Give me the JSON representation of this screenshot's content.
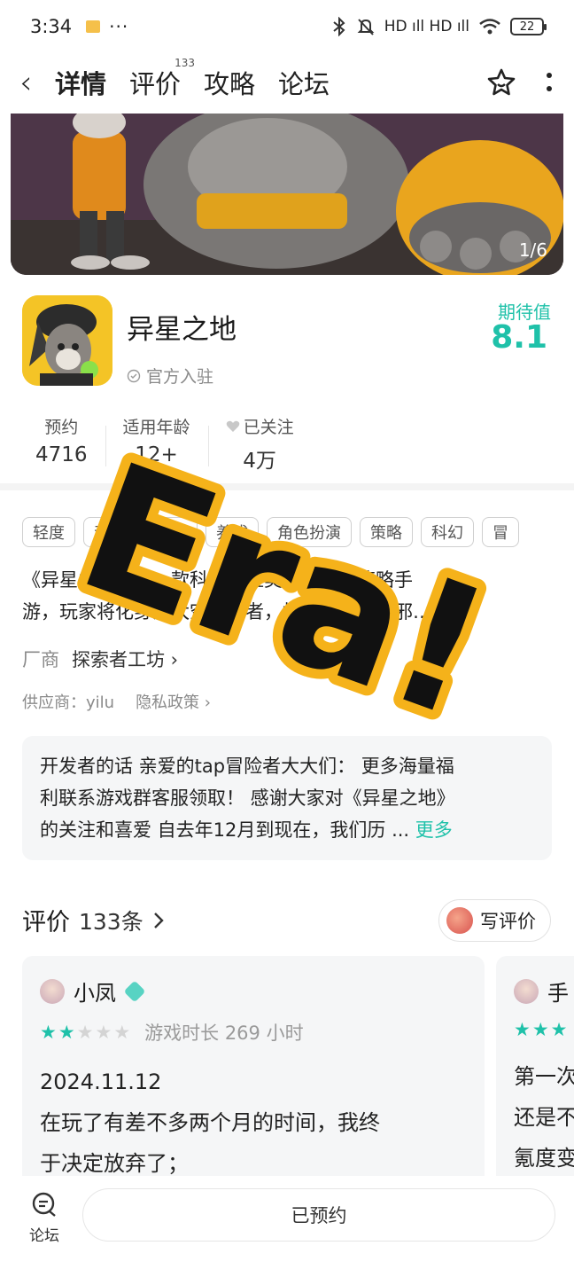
{
  "status_bar": {
    "time": "3:34",
    "dots": "···",
    "signal": "HD ıll HD ıll",
    "battery": "22"
  },
  "nav": {
    "tabs": [
      {
        "label": "详情"
      },
      {
        "label": "评价",
        "count": "133"
      },
      {
        "label": "攻略"
      },
      {
        "label": "论坛"
      }
    ]
  },
  "banner": {
    "counter": "1/6"
  },
  "app": {
    "name": "异星之地",
    "official": "官方入驻",
    "expect_label": "期待值",
    "expect_value": "8.1"
  },
  "stats": [
    {
      "label": "预约",
      "value": "4716"
    },
    {
      "label": "适用年龄",
      "value": "12+"
    },
    {
      "label": "已关注",
      "value": "4万"
    }
  ],
  "tags": [
    "轻度",
    "动作",
    "射击",
    "养成",
    "角色扮演",
    "策略",
    "科幻",
    "冒"
  ],
  "description": {
    "line1": "《异星之地》是一款科幻冒险类型的竞技策略手",
    "line2": "游，玩家将化身为太空冒险者，投身于梦境从邪…"
  },
  "vendor": {
    "label": "厂商",
    "name": "探索者工坊 ›"
  },
  "supplier": {
    "text": "供应商：yilu",
    "privacy": "隐私政策 ›"
  },
  "dev_note": {
    "line1": "开发者的话  亲爱的tap冒险者大大们：  更多海量福",
    "line2": "利联系游戏群客服领取！  感谢大家对《异星之地》",
    "line3": "的关注和喜爱 自去年12月到现在，我们历 ... ",
    "more": "更多"
  },
  "reviews": {
    "title": "评价",
    "count": "133条",
    "write_label": "写评价",
    "items": [
      {
        "user": "小凤",
        "stars": 2,
        "playtime": "游戏时长 269 小时",
        "date": "2024.11.12",
        "line1": "在玩了有差不多两个月的时间，我终",
        "line2": "于决定放弃了；"
      },
      {
        "user": "手",
        "stars": 3,
        "line1": "第一次",
        "line2": "还是不",
        "line3": "氪度变"
      }
    ]
  },
  "bottom_bar": {
    "forum_label": "论坛",
    "booked_label": "已预约"
  },
  "sticker": {
    "text": "Era!",
    "fill": "#111111",
    "outline": "#f5b21a"
  },
  "colors": {
    "accent": "#1fc1a9",
    "card_bg": "#f5f6f7"
  }
}
